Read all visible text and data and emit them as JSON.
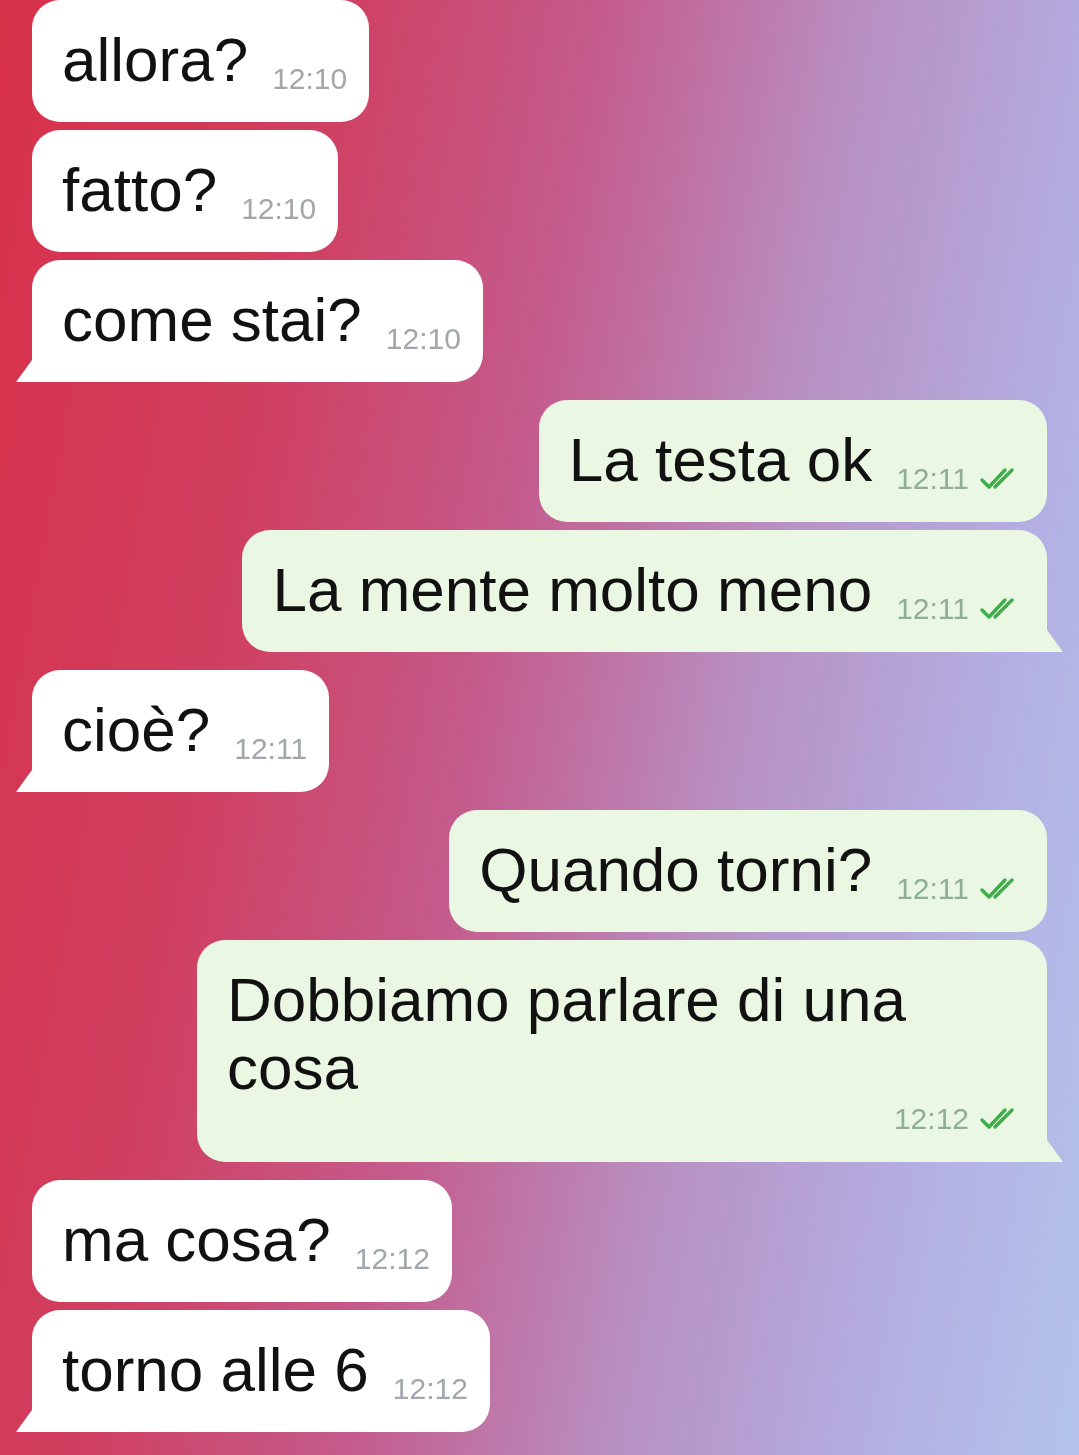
{
  "messages": [
    {
      "outgoing": false,
      "text": "allora?",
      "time": "12:10",
      "tail": false
    },
    {
      "outgoing": false,
      "text": "fatto?",
      "time": "12:10",
      "tail": false
    },
    {
      "outgoing": false,
      "text": "come stai?",
      "time": "12:10",
      "tail": true
    },
    {
      "outgoing": true,
      "text": "La testa ok",
      "time": "12:11",
      "tail": false,
      "read": true
    },
    {
      "outgoing": true,
      "text": "La mente molto meno",
      "time": "12:11",
      "tail": true,
      "read": true
    },
    {
      "outgoing": false,
      "text": "cioè?",
      "time": "12:11",
      "tail": true
    },
    {
      "outgoing": true,
      "text": "Quando torni?",
      "time": "12:11",
      "tail": false,
      "read": true
    },
    {
      "outgoing": true,
      "text": "Dobbiamo parlare di una cosa",
      "time": "12:12",
      "tail": true,
      "read": true
    },
    {
      "outgoing": false,
      "text": "ma cosa?",
      "time": "12:12",
      "tail": false
    },
    {
      "outgoing": false,
      "text": "torno alle 6",
      "time": "12:12",
      "tail": true
    }
  ]
}
